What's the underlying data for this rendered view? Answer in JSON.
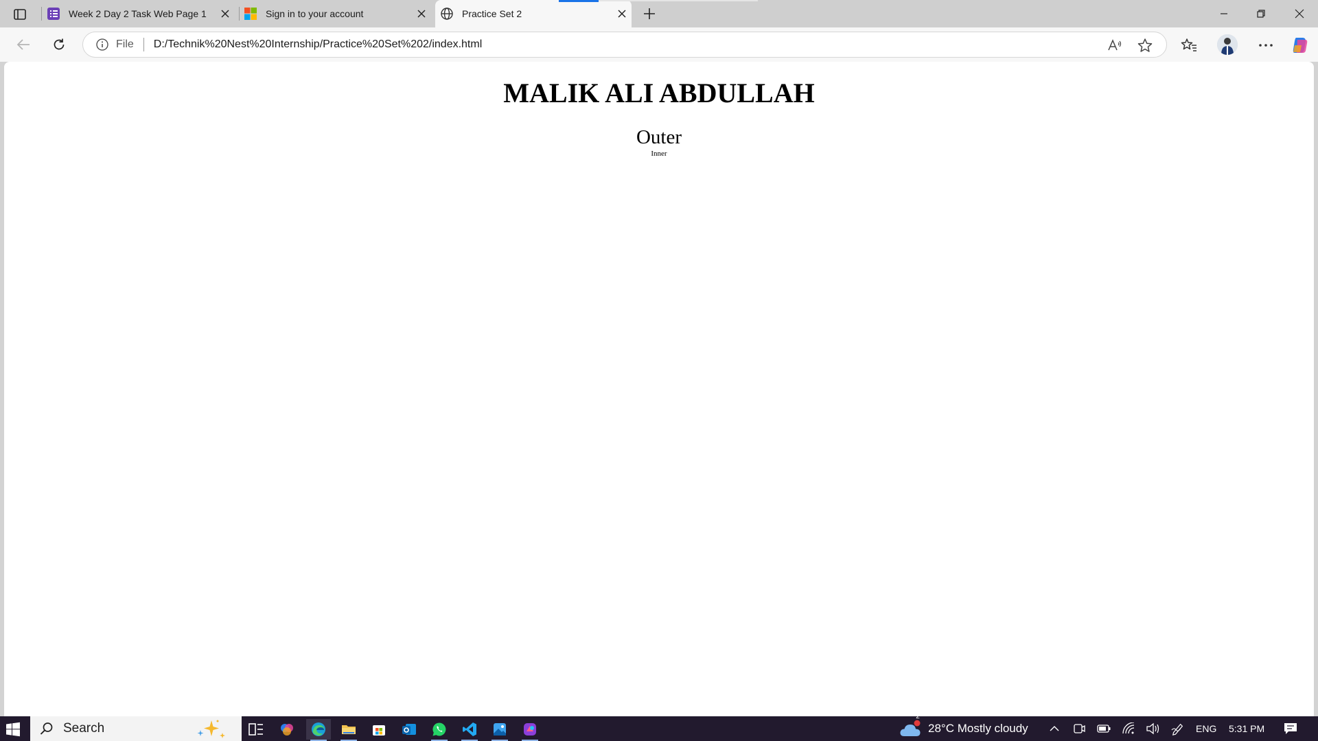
{
  "browser": {
    "tabs": [
      {
        "title": "Week 2 Day 2 Task Web Page 1",
        "favicon": "forms-icon",
        "active": false
      },
      {
        "title": "Sign in to your account",
        "favicon": "microsoft-logo-icon",
        "active": false
      },
      {
        "title": "Practice Set 2",
        "favicon": "globe-icon",
        "active": true
      }
    ],
    "address_bar": {
      "scheme_label": "File",
      "url": "D:/Technik%20Nest%20Internship/Practice%20Set%202/index.html"
    }
  },
  "page": {
    "heading": "MALIK ALI ABDULLAH",
    "outer": "Outer",
    "inner": "Inner"
  },
  "taskbar": {
    "search_label": "Search",
    "apps": [
      "task-view",
      "copilot",
      "edge",
      "file-explorer",
      "microsoft-store",
      "outlook",
      "whatsapp",
      "vs-code",
      "photos",
      "canva"
    ],
    "weather": {
      "badge": "2",
      "text": "28°C  Mostly cloudy"
    },
    "language": "ENG",
    "time": "5:31 PM"
  },
  "colors": {
    "accent": "#1a73e8",
    "taskbar": "#221a2e",
    "tab_strip": "#cfcfcf",
    "toolbar": "#f7f7f7"
  }
}
